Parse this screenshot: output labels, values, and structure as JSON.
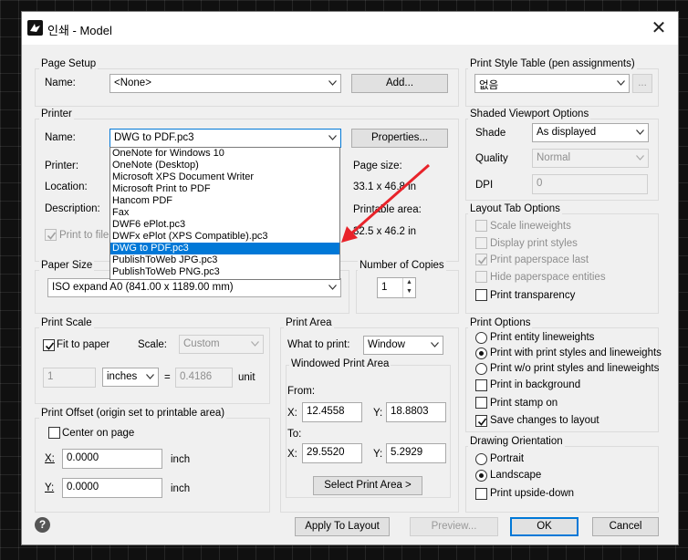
{
  "window": {
    "title": "인쇄 - Model",
    "close": "✕"
  },
  "page_setup": {
    "group_label": "Page Setup",
    "name_label": "Name:",
    "name_value": "<None>",
    "add_button": "Add..."
  },
  "printer": {
    "group_label": "Printer",
    "name_label": "Name:",
    "name_value": "DWG to PDF.pc3",
    "properties_button": "Properties...",
    "printer_label": "Printer:",
    "location_label": "Location:",
    "description_label": "Description:",
    "print_to_file": "Print to file",
    "page_size_label": "Page size:",
    "page_size_value": "33.1 x 46.8 in",
    "printable_area_label": "Printable area:",
    "printable_area_value": "32.5 x 46.2 in",
    "dropdown_options": [
      "OneNote for Windows 10",
      "OneNote (Desktop)",
      "Microsoft XPS Document Writer",
      "Microsoft Print to PDF",
      "Hancom PDF",
      "Fax",
      "DWF6 ePlot.pc3",
      "DWFx ePlot (XPS Compatible).pc3",
      "DWG to PDF.pc3",
      "PublishToWeb JPG.pc3",
      "PublishToWeb PNG.pc3"
    ],
    "dropdown_selected_index": 8
  },
  "paper_size": {
    "group_label": "Paper Size",
    "value": "ISO expand A0 (841.00 x 1189.00 mm)"
  },
  "copies": {
    "group_label": "Number of Copies",
    "value": "1"
  },
  "print_scale": {
    "group_label": "Print Scale",
    "fit_to_paper": "Fit to paper",
    "scale_label": "Scale:",
    "scale_value": "Custom",
    "value1": "1",
    "units": "inches",
    "equals": "=",
    "value2": "0.4186",
    "unit_label": "unit"
  },
  "print_offset": {
    "group_label": "Print Offset (origin set to printable area)",
    "center_on_page": "Center on page",
    "x_label": "X:",
    "x_value": "0.0000",
    "x_unit": "inch",
    "y_label": "Y:",
    "y_value": "0.0000",
    "y_unit": "inch"
  },
  "print_area": {
    "group_label": "Print Area",
    "what_label": "What to print:",
    "what_value": "Window",
    "windowed_label": "Windowed Print Area",
    "from_label": "From:",
    "to_label": "To:",
    "x_label": "X:",
    "y_label": "Y:",
    "from_x": "12.4558",
    "from_y": "18.8803",
    "to_x": "29.5520",
    "to_y": "5.2929",
    "select_button": "Select Print Area >"
  },
  "print_style_table": {
    "group_label": "Print Style Table (pen assignments)",
    "value": "없음",
    "edit_button": "..."
  },
  "shaded_viewport": {
    "group_label": "Shaded Viewport Options",
    "shade_label": "Shade",
    "shade_value": "As displayed",
    "quality_label": "Quality",
    "quality_value": "Normal",
    "dpi_label": "DPI",
    "dpi_value": "0"
  },
  "layout_tab": {
    "group_label": "Layout Tab Options",
    "items": [
      "Scale lineweights",
      "Display print styles",
      "Print paperspace last",
      "Hide paperspace entities",
      "Print transparency"
    ]
  },
  "print_options": {
    "group_label": "Print Options",
    "items": [
      "Print entity lineweights",
      "Print with print styles and lineweights",
      "Print w/o print styles and lineweights",
      "Print in background",
      "Print stamp on",
      "Save changes to layout"
    ]
  },
  "orientation": {
    "group_label": "Drawing Orientation",
    "items": [
      "Portrait",
      "Landscape",
      "Print upside-down"
    ]
  },
  "footer": {
    "help": "?",
    "apply": "Apply To Layout",
    "preview": "Preview...",
    "ok": "OK",
    "cancel": "Cancel"
  },
  "colors": {
    "accent": "#0078d7",
    "annotation_arrow": "#e8232a"
  }
}
